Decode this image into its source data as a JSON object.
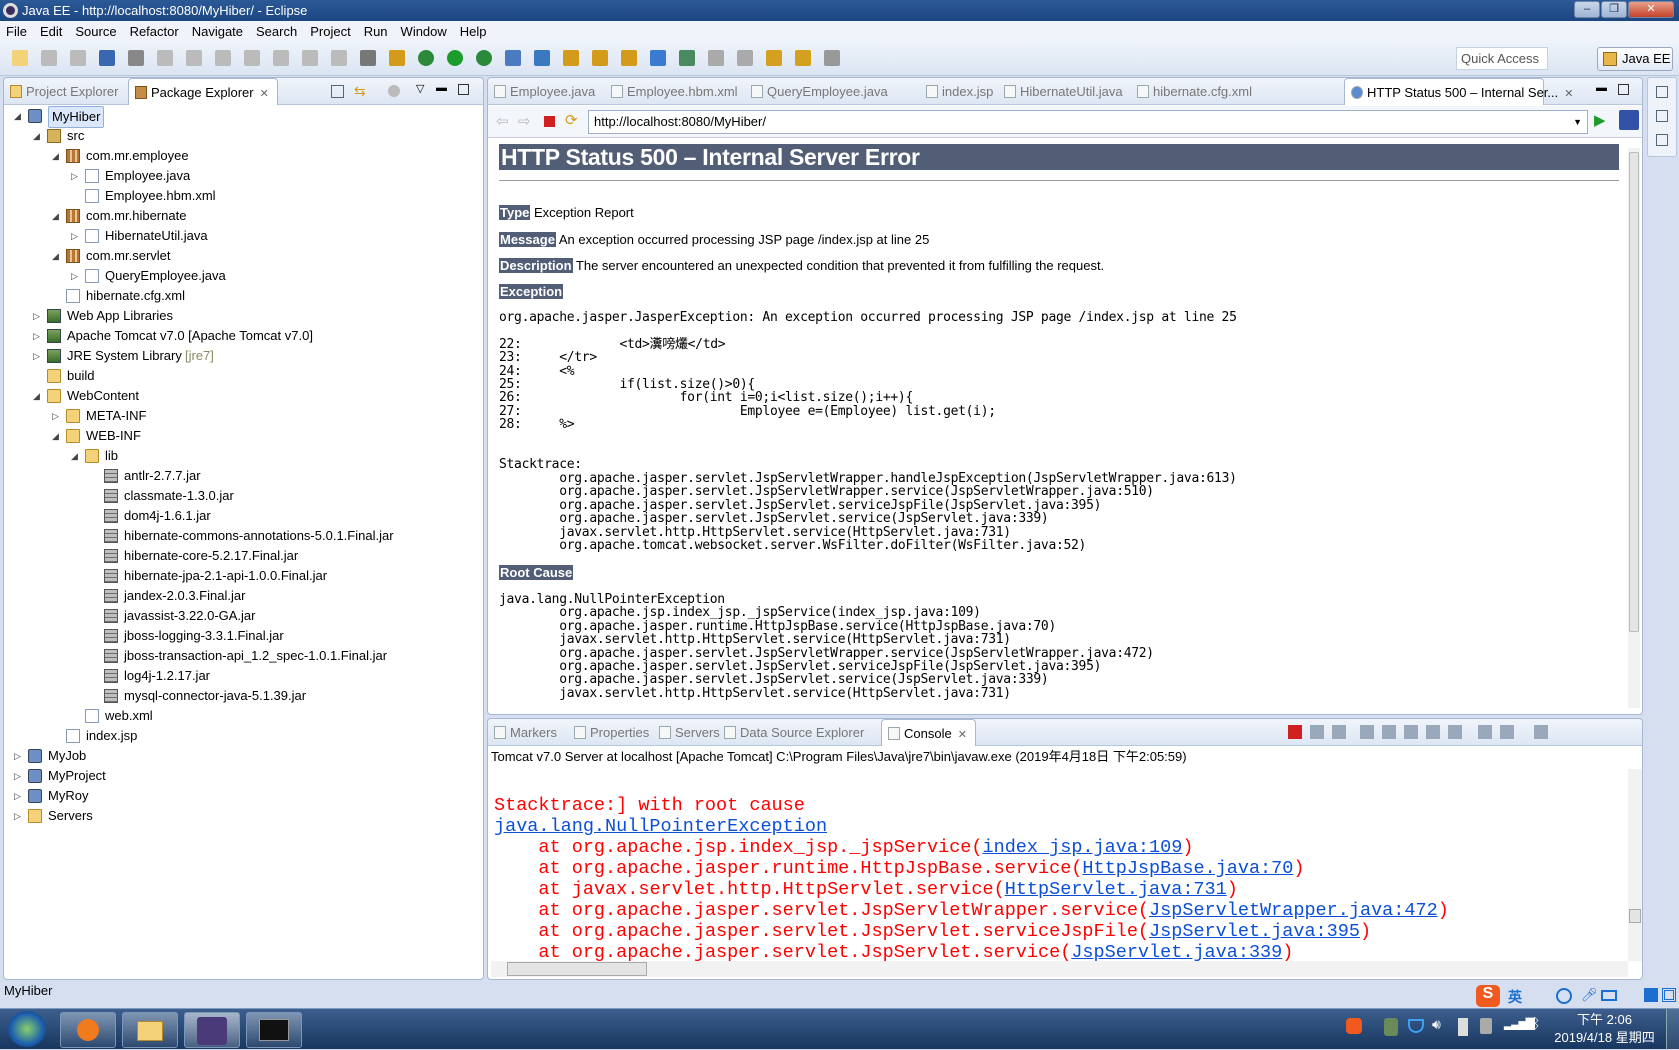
{
  "window": {
    "title": "Java EE - http://localhost:8080/MyHiber/ - Eclipse"
  },
  "menu": [
    "File",
    "Edit",
    "Source",
    "Refactor",
    "Navigate",
    "Search",
    "Project",
    "Run",
    "Window",
    "Help"
  ],
  "toolbar": {
    "quick_access": "Quick Access",
    "perspective": "Java EE"
  },
  "left_panel": {
    "tabs": [
      {
        "label": "Project Explorer",
        "active": false
      },
      {
        "label": "Package Explorer",
        "active": true
      }
    ],
    "tree": [
      {
        "d": 0,
        "e": "open",
        "i": "project",
        "t": "MyHiber",
        "sel": true
      },
      {
        "d": 1,
        "e": "open",
        "i": "src",
        "t": "src"
      },
      {
        "d": 2,
        "e": "open",
        "i": "package",
        "t": "com.mr.employee"
      },
      {
        "d": 3,
        "e": "closed",
        "i": "java",
        "t": "Employee.java"
      },
      {
        "d": 3,
        "e": "",
        "i": "xml",
        "t": "Employee.hbm.xml"
      },
      {
        "d": 2,
        "e": "open",
        "i": "package",
        "t": "com.mr.hibernate"
      },
      {
        "d": 3,
        "e": "closed",
        "i": "java",
        "t": "HibernateUtil.java"
      },
      {
        "d": 2,
        "e": "open",
        "i": "package",
        "t": "com.mr.servlet"
      },
      {
        "d": 3,
        "e": "closed",
        "i": "java",
        "t": "QueryEmployee.java"
      },
      {
        "d": 2,
        "e": "",
        "i": "xml",
        "t": "hibernate.cfg.xml"
      },
      {
        "d": 1,
        "e": "closed",
        "i": "lib",
        "t": "Web App Libraries"
      },
      {
        "d": 1,
        "e": "closed",
        "i": "lib",
        "t": "Apache Tomcat v7.0 [Apache Tomcat v7.0]"
      },
      {
        "d": 1,
        "e": "closed",
        "i": "lib",
        "t": "JRE System Library",
        "s": "[jre7]"
      },
      {
        "d": 1,
        "e": "",
        "i": "folder",
        "t": "build"
      },
      {
        "d": 1,
        "e": "open",
        "i": "folder",
        "t": "WebContent"
      },
      {
        "d": 2,
        "e": "closed",
        "i": "folder",
        "t": "META-INF"
      },
      {
        "d": 2,
        "e": "open",
        "i": "folder",
        "t": "WEB-INF"
      },
      {
        "d": 3,
        "e": "open",
        "i": "folder",
        "t": "lib"
      },
      {
        "d": 4,
        "e": "",
        "i": "jar",
        "t": "antlr-2.7.7.jar"
      },
      {
        "d": 4,
        "e": "",
        "i": "jar",
        "t": "classmate-1.3.0.jar"
      },
      {
        "d": 4,
        "e": "",
        "i": "jar",
        "t": "dom4j-1.6.1.jar"
      },
      {
        "d": 4,
        "e": "",
        "i": "jar",
        "t": "hibernate-commons-annotations-5.0.1.Final.jar"
      },
      {
        "d": 4,
        "e": "",
        "i": "jar",
        "t": "hibernate-core-5.2.17.Final.jar"
      },
      {
        "d": 4,
        "e": "",
        "i": "jar",
        "t": "hibernate-jpa-2.1-api-1.0.0.Final.jar"
      },
      {
        "d": 4,
        "e": "",
        "i": "jar",
        "t": "jandex-2.0.3.Final.jar"
      },
      {
        "d": 4,
        "e": "",
        "i": "jar",
        "t": "javassist-3.22.0-GA.jar"
      },
      {
        "d": 4,
        "e": "",
        "i": "jar",
        "t": "jboss-logging-3.3.1.Final.jar"
      },
      {
        "d": 4,
        "e": "",
        "i": "jar",
        "t": "jboss-transaction-api_1.2_spec-1.0.1.Final.jar"
      },
      {
        "d": 4,
        "e": "",
        "i": "jar",
        "t": "log4j-1.2.17.jar"
      },
      {
        "d": 4,
        "e": "",
        "i": "jar",
        "t": "mysql-connector-java-5.1.39.jar"
      },
      {
        "d": 3,
        "e": "",
        "i": "xml",
        "t": "web.xml"
      },
      {
        "d": 2,
        "e": "",
        "i": "jsp",
        "t": "index.jsp"
      },
      {
        "d": 0,
        "e": "closed",
        "i": "project",
        "t": "MyJob"
      },
      {
        "d": 0,
        "e": "closed",
        "i": "project",
        "t": "MyProject"
      },
      {
        "d": 0,
        "e": "closed",
        "i": "project",
        "t": "MyRoy"
      },
      {
        "d": 0,
        "e": "closed",
        "i": "folder",
        "t": "Servers"
      }
    ]
  },
  "editor": {
    "tabs": [
      "Employee.java",
      "Employee.hbm.xml",
      "QueryEmployee.java",
      "index.jsp",
      "HibernateUtil.java",
      "hibernate.cfg.xml",
      "HTTP Status 500 – Internal Ser..."
    ],
    "url": "http://localhost:8080/MyHiber/",
    "page": {
      "title": "HTTP Status 500 – Internal Server Error",
      "type_label": "Type",
      "type": "Exception Report",
      "message_label": "Message",
      "message": "An exception occurred processing JSP page /index.jsp at line 25",
      "description_label": "Description",
      "description": "The server encountered an unexpected condition that prevented it from fulfilling the request.",
      "exception_label": "Exception",
      "exception": "org.apache.jasper.JasperException: An exception occurred processing JSP page /index.jsp at line 25\n\n22: \t\t<td>瀵嗙爜</td>\n23: \t</tr>\n24: \t<%\n25: \t\tif(list.size()>0){\n26: \t\t\tfor(int i=0;i<list.size();i++){\n27: \t\t\t\tEmployee e=(Employee) list.get(i);\n28: \t%>\n\n\nStacktrace:\n\torg.apache.jasper.servlet.JspServletWrapper.handleJspException(JspServletWrapper.java:613)\n\torg.apache.jasper.servlet.JspServletWrapper.service(JspServletWrapper.java:510)\n\torg.apache.jasper.servlet.JspServlet.serviceJspFile(JspServlet.java:395)\n\torg.apache.jasper.servlet.JspServlet.service(JspServlet.java:339)\n\tjavax.servlet.http.HttpServlet.service(HttpServlet.java:731)\n\torg.apache.tomcat.websocket.server.WsFilter.doFilter(WsFilter.java:52)",
      "root_cause_label": "Root Cause",
      "root_cause": "java.lang.NullPointerException\n\torg.apache.jsp.index_jsp._jspService(index_jsp.java:109)\n\torg.apache.jasper.runtime.HttpJspBase.service(HttpJspBase.java:70)\n\tjavax.servlet.http.HttpServlet.service(HttpServlet.java:731)\n\torg.apache.jasper.servlet.JspServletWrapper.service(JspServletWrapper.java:472)\n\torg.apache.jasper.servlet.JspServlet.serviceJspFile(JspServlet.java:395)\n\torg.apache.jasper.servlet.JspServlet.service(JspServlet.java:339)\n\tjavax.servlet.http.HttpServlet.service(HttpServlet.java:731)\n\torg.apache.tomcat.websocket.server.WsFilter.doFilter(WsFilter.java:52)"
    }
  },
  "bottom": {
    "tabs": [
      "Markers",
      "Properties",
      "Servers",
      "Data Source Explorer",
      "Console"
    ],
    "console_header": "Tomcat v7.0 Server at localhost [Apache Tomcat] C:\\Program Files\\Java\\jre7\\bin\\javaw.exe (2019年4月18日 下午2:05:59)",
    "lines": [
      {
        "text": "Stacktrace:] with root cause",
        "link": ""
      },
      {
        "text": "",
        "link": "java.lang.NullPointerException"
      },
      {
        "text": "\tat org.apache.jsp.index_jsp._jspService(",
        "link": "index_jsp.java:109"
      },
      {
        "text": "\tat org.apache.jasper.runtime.HttpJspBase.service(",
        "link": "HttpJspBase.java:70"
      },
      {
        "text": "\tat javax.servlet.http.HttpServlet.service(",
        "link": "HttpServlet.java:731"
      },
      {
        "text": "\tat org.apache.jasper.servlet.JspServletWrapper.service(",
        "link": "JspServletWrapper.java:472"
      },
      {
        "text": "\tat org.apache.jasper.servlet.JspServlet.serviceJspFile(",
        "link": "JspServlet.java:395"
      },
      {
        "text": "\tat org.apache.jasper.servlet.JspServlet.service(",
        "link": "JspServlet.java:339"
      }
    ]
  },
  "status": {
    "text": "MyHiber"
  },
  "tray": {
    "ime": "英",
    "time": "下午 2:06",
    "date": "2019/4/18 星期四"
  },
  "colors": {
    "header_bg": "#525d76",
    "console_error": "#ff0000",
    "console_link": "#0b4fd8",
    "title_bar": "#1c4680"
  }
}
